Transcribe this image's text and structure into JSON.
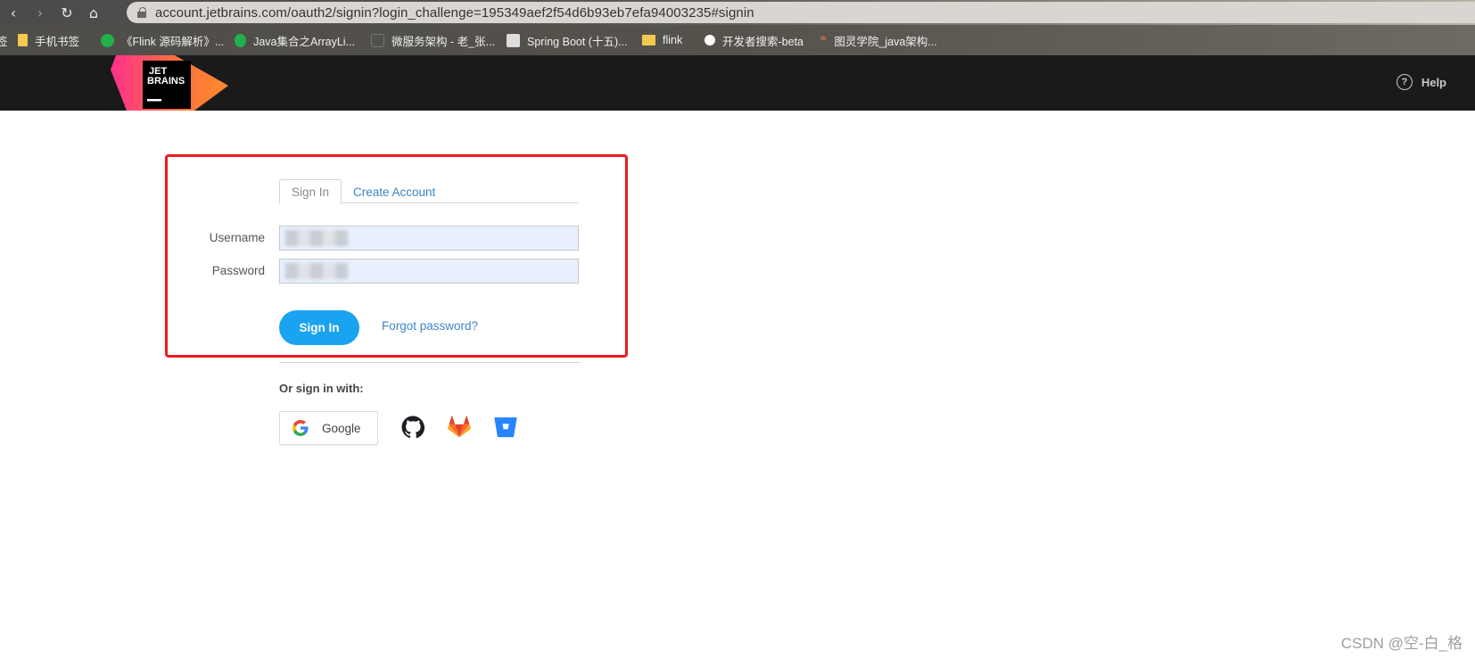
{
  "browser": {
    "url": "account.jetbrains.com/oauth2/signin?login_challenge=195349aef2f54d6b93eb7efa94003235#signin",
    "bookmarks": [
      {
        "label": "签",
        "icon": "bookmark-folder-icon",
        "color": ""
      },
      {
        "label": "手机书签",
        "icon": "mobile-bookmark-icon",
        "color": "#f2c94c"
      },
      {
        "label": "《Flink 源码解析》...",
        "icon": "wechat-icon",
        "color": "#22b04b"
      },
      {
        "label": "Java集合之ArrayLi...",
        "icon": "wechat-icon",
        "color": "#22b04b"
      },
      {
        "label": "微服务架构 - 老_张...",
        "icon": "page-icon",
        "color": "#666666"
      },
      {
        "label": "Spring Boot (十五)...",
        "icon": "page-icon",
        "color": "#dddddd"
      },
      {
        "label": "flink",
        "icon": "folder-icon",
        "color": "#f2c94c"
      },
      {
        "label": "开发者搜索-beta",
        "icon": "search-site-icon",
        "color": "#ffffff"
      },
      {
        "label": "图灵学院_java架构...",
        "icon": "tuling-icon",
        "color": "#e07b3c"
      }
    ]
  },
  "header": {
    "logo_line1": "JET",
    "logo_line2": "BRAINS",
    "help_label": "Help"
  },
  "form": {
    "tab_signin": "Sign In",
    "tab_create": "Create Account",
    "username_label": "Username",
    "password_label": "Password",
    "signin_button": "Sign In",
    "forgot_link": "Forgot password?",
    "or_sign_in_with": "Or sign in with:",
    "google_label": "Google",
    "accent_color": "#1aa3f0",
    "highlight_color": "#ee1c1c"
  },
  "watermark": "CSDN @空-白_格"
}
